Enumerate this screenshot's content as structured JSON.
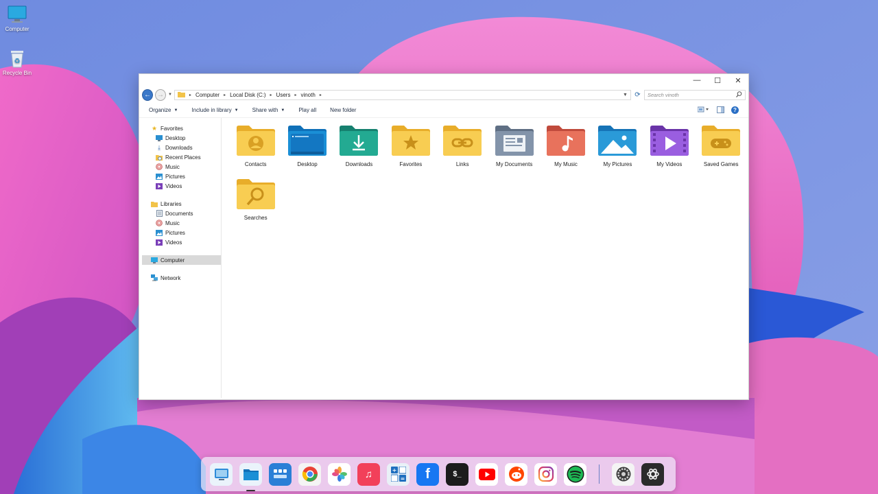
{
  "desktop": {
    "icons": [
      {
        "label": "Computer",
        "icon": "monitor-icon"
      },
      {
        "label": "Recycle Bin",
        "icon": "recycle-bin-icon"
      }
    ]
  },
  "window": {
    "controls": {
      "minimize": "—",
      "maximize": "☐",
      "close": "✕"
    },
    "nav": {
      "back": "←",
      "forward": "→"
    },
    "breadcrumb": [
      "Computer",
      "Local Disk (C:)",
      "Users",
      "vinoth"
    ],
    "search_placeholder": "Search vinoth",
    "toolbar": {
      "organize": "Organize",
      "include_in_library": "Include in library",
      "share_with": "Share with",
      "play_all": "Play all",
      "new_folder": "New folder"
    },
    "navpane": {
      "favorites": {
        "label": "Favorites",
        "items": [
          "Desktop",
          "Downloads",
          "Recent Places",
          "Music",
          "Pictures",
          "Videos"
        ]
      },
      "libraries": {
        "label": "Libraries",
        "items": [
          "Documents",
          "Music",
          "Pictures",
          "Videos"
        ]
      },
      "computer": "Computer",
      "network": "Network"
    },
    "folders": [
      {
        "label": "Contacts",
        "icon": "contacts-folder-icon",
        "color": "#f4c542"
      },
      {
        "label": "Desktop",
        "icon": "desktop-folder-icon",
        "color": "#1a8fd6"
      },
      {
        "label": "Downloads",
        "icon": "downloads-folder-icon",
        "color": "#1f9e8a"
      },
      {
        "label": "Favorites",
        "icon": "favorites-folder-icon",
        "color": "#f4c542"
      },
      {
        "label": "Links",
        "icon": "links-folder-icon",
        "color": "#f4c542"
      },
      {
        "label": "My Documents",
        "icon": "documents-folder-icon",
        "color": "#7d8ea3"
      },
      {
        "label": "My Music",
        "icon": "music-folder-icon",
        "color": "#e0604f"
      },
      {
        "label": "My Pictures",
        "icon": "pictures-folder-icon",
        "color": "#2a9ad8"
      },
      {
        "label": "My Videos",
        "icon": "videos-folder-icon",
        "color": "#8a4fd0"
      },
      {
        "label": "Saved Games",
        "icon": "games-folder-icon",
        "color": "#f4c542"
      },
      {
        "label": "Searches",
        "icon": "searches-folder-icon",
        "color": "#f4c542"
      }
    ]
  },
  "dock": {
    "apps": [
      {
        "name": "finder",
        "icon": "finder-icon"
      },
      {
        "name": "files",
        "icon": "files-icon"
      },
      {
        "name": "launchpad",
        "icon": "launchpad-icon"
      },
      {
        "name": "chrome",
        "icon": "chrome-icon"
      },
      {
        "name": "photos",
        "icon": "photos-icon"
      },
      {
        "name": "music",
        "icon": "music-icon"
      },
      {
        "name": "calculator",
        "icon": "calculator-icon"
      },
      {
        "name": "facebook",
        "icon": "facebook-icon"
      },
      {
        "name": "terminal",
        "icon": "terminal-icon"
      },
      {
        "name": "youtube",
        "icon": "youtube-icon"
      },
      {
        "name": "reddit",
        "icon": "reddit-icon"
      },
      {
        "name": "instagram",
        "icon": "instagram-icon"
      },
      {
        "name": "spotify",
        "icon": "spotify-icon"
      },
      {
        "name": "settings",
        "icon": "settings-icon"
      },
      {
        "name": "chatgpt",
        "icon": "chatgpt-icon"
      }
    ]
  }
}
